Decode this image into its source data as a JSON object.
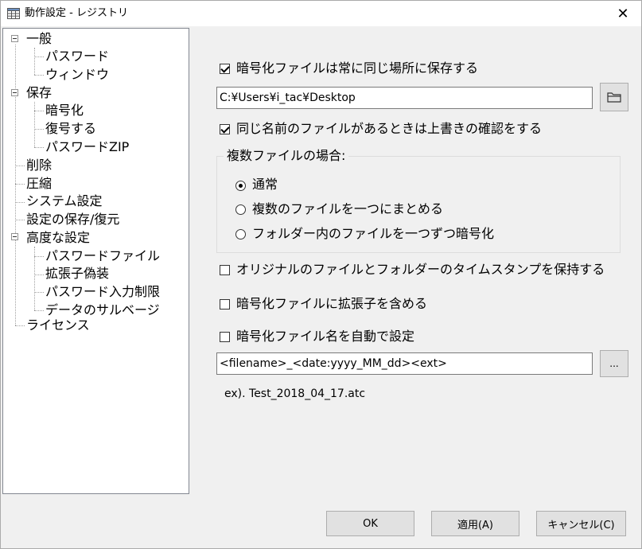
{
  "window": {
    "title": "動作設定 - レジストリ",
    "close_glyph": "✕"
  },
  "tree": {
    "items": [
      {
        "label": "一般"
      },
      {
        "label": "パスワード"
      },
      {
        "label": "ウィンドウ"
      },
      {
        "label": "保存"
      },
      {
        "label": "暗号化"
      },
      {
        "label": "復号する"
      },
      {
        "label": "パスワードZIP"
      },
      {
        "label": "削除"
      },
      {
        "label": "圧縮"
      },
      {
        "label": "システム設定"
      },
      {
        "label": "設定の保存/復元"
      },
      {
        "label": "高度な設定"
      },
      {
        "label": "パスワードファイル"
      },
      {
        "label": "拡張子偽装"
      },
      {
        "label": "パスワード入力制限"
      },
      {
        "label": "データのサルベージ"
      },
      {
        "label": "ライセンス"
      }
    ]
  },
  "main": {
    "save_same_place": {
      "label": "暗号化ファイルは常に同じ場所に保存する",
      "checked": true
    },
    "save_path": {
      "value": "C:¥Users¥i_tac¥Desktop"
    },
    "confirm_overwrite": {
      "label": "同じ名前のファイルがあるときは上書きの確認をする",
      "checked": true
    },
    "multiple_files": {
      "group_label": "複数ファイルの場合:",
      "options": [
        {
          "label": "通常",
          "checked": true
        },
        {
          "label": "複数のファイルを一つにまとめる",
          "checked": false
        },
        {
          "label": "フォルダー内のファイルを一つずつ暗号化",
          "checked": false
        }
      ]
    },
    "keep_timestamp": {
      "label": "オリジナルのファイルとフォルダーのタイムスタンプを保持する",
      "checked": false
    },
    "include_extension": {
      "label": "暗号化ファイルに拡張子を含める",
      "checked": false
    },
    "auto_filename": {
      "label": "暗号化ファイル名を自動で設定",
      "checked": false
    },
    "filename_format": {
      "value": "<filename>_<date:yyyy_MM_dd><ext>"
    },
    "more_button_label": "...",
    "example_text": "ex). Test_2018_04_17.atc"
  },
  "footer": {
    "ok_label": "OK",
    "apply_label": "適用(A)",
    "cancel_label": "キャンセル(C)"
  }
}
